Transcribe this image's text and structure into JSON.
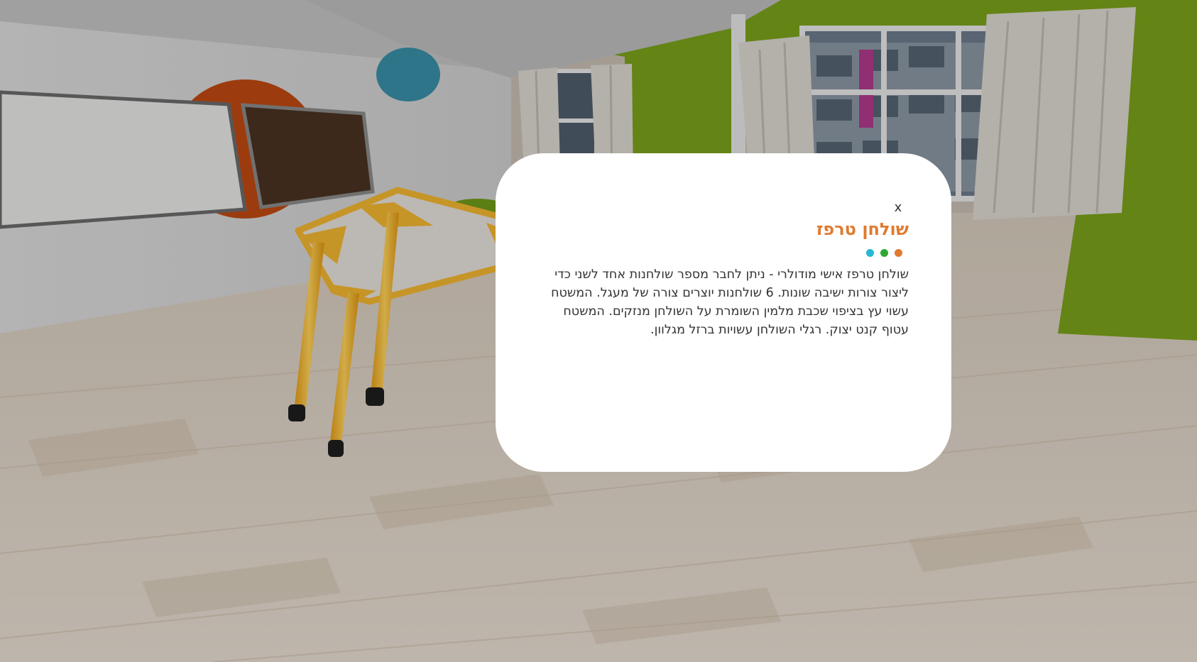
{
  "popup": {
    "close_label": "x",
    "title": "שולחן טרפז",
    "body": "שולחן טרפז אישי מודולרי - ניתן לחבר מספר שולחנות אחד לשני כדי ליצור צורות ישיבה שונות. 6 שולחנות יוצרים צורה של מעגל. המשטח עשוי עץ בציפוי שכבת מלמין השומרת על השולחן מנזקים. המשטח עטוף קנט יצוק. רגלי השולחן עשויות ברזל מגלוון.",
    "dots": [
      {
        "color": "#25b8d6",
        "name": "cyan"
      },
      {
        "color": "#2fa82f",
        "name": "green"
      },
      {
        "color": "#e07a2f",
        "name": "orange"
      }
    ]
  },
  "colors": {
    "accent": "#e07a2f",
    "wall_green": "#7aa21c",
    "table_yellow": "#f2b630",
    "floor": "#d9ccbd"
  }
}
